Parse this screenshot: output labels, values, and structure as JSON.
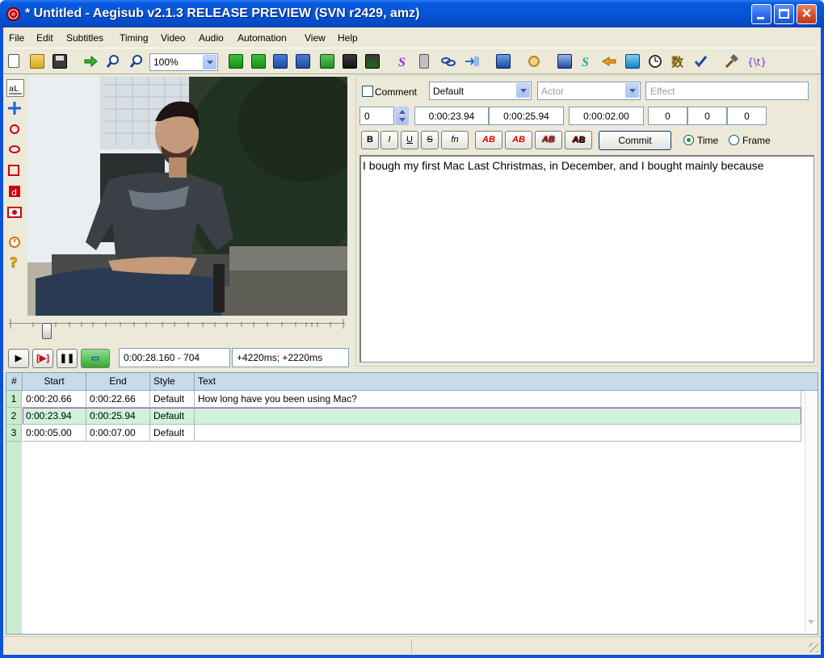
{
  "window": {
    "title": "* Untitled - Aegisub v2.1.3 RELEASE PREVIEW (SVN r2429, amz)"
  },
  "menu": [
    "File",
    "Edit",
    "Subtitles",
    "Timing",
    "Video",
    "Audio",
    "Automation",
    "View",
    "Help"
  ],
  "toolbar": {
    "zoom": "100%",
    "icons": [
      "new-file-icon",
      "open-folder-icon",
      "save-icon",
      "jump-to-icon",
      "zoom-in-icon",
      "zoom-out-icon",
      "snap-start-icon",
      "snap-end-icon",
      "video-start-icon",
      "video-end-icon",
      "shift-icon",
      "keyframe-icon",
      "style-manager-icon",
      "properties-icon",
      "attachments-icon",
      "fonts-collector-icon",
      "automation-icon",
      "resample-icon",
      "timing-processor-icon",
      "kanji-timer-icon",
      "translation-icon",
      "spell-check-icon",
      "tags-icon"
    ]
  },
  "video_controls": {
    "time": "0:00:28.160 - 704",
    "offset": "+4220ms; +2220ms"
  },
  "editor": {
    "comment_label": "Comment",
    "style": "Default",
    "actor_placeholder": "Actor",
    "effect_placeholder": "Effect",
    "layer": "0",
    "start_time": "0:00:23.94",
    "end_time": "0:00:25.94",
    "duration": "0:00:02.00",
    "margin_l": "0",
    "margin_r": "0",
    "margin_v": "0",
    "format_buttons": [
      "B",
      "I",
      "U",
      "S",
      "fn"
    ],
    "color_buttons": [
      "AB",
      "AB",
      "AB",
      "AB"
    ],
    "commit_label": "Commit",
    "time_label": "Time",
    "frame_label": "Frame",
    "text": "I bough my first Mac Last Christmas, in December, and I bought mainly because"
  },
  "grid": {
    "headers": [
      "#",
      "Start",
      "End",
      "Style",
      "Text"
    ],
    "rows": [
      {
        "num": "1",
        "start": "0:00:20.66",
        "end": "0:00:22.66",
        "style": "Default",
        "text": "How long have you been using Mac?"
      },
      {
        "num": "2",
        "start": "0:00:23.94",
        "end": "0:00:25.94",
        "style": "Default",
        "text": ""
      },
      {
        "num": "3",
        "start": "0:00:05.00",
        "end": "0:00:07.00",
        "style": "Default",
        "text": ""
      }
    ],
    "selected_row": 2
  },
  "colors": {
    "titlebar": "#0755d6",
    "selected_row": "#cff3dd",
    "selected_border": "#b14eae",
    "grid_header": "#c7dbe9"
  }
}
